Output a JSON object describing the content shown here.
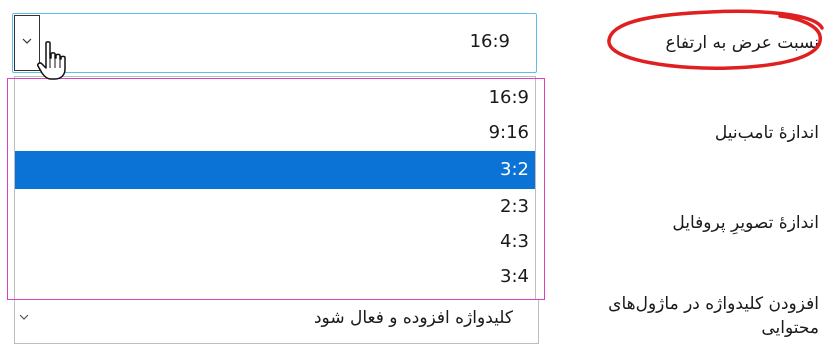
{
  "labels": {
    "aspect_ratio": "نسبت عرض به ارتفاع",
    "thumbnail_size": "اندازهٔ تامب‌نیل",
    "profile_image_size": "اندازهٔ تصویرِ پروفایل",
    "keyword_in_modules": "افزودن کلیدواژه در ماژول‌های محتوایی"
  },
  "aspect_select": {
    "value": "16:9",
    "options": [
      "16:9",
      "9:16",
      "3:2",
      "2:3",
      "4:3",
      "3:4"
    ],
    "highlighted": "3:2"
  },
  "keyword_select": {
    "value": "کلیدواژه افزوده و فعال شود"
  },
  "colors": {
    "highlight": "#0c73d6",
    "focus_border": "#5cc0e6",
    "annotation_red": "#e02020",
    "annotation_magenta": "#e040c0"
  },
  "icons": [
    "chevron-down-icon",
    "hand-pointer-icon"
  ]
}
